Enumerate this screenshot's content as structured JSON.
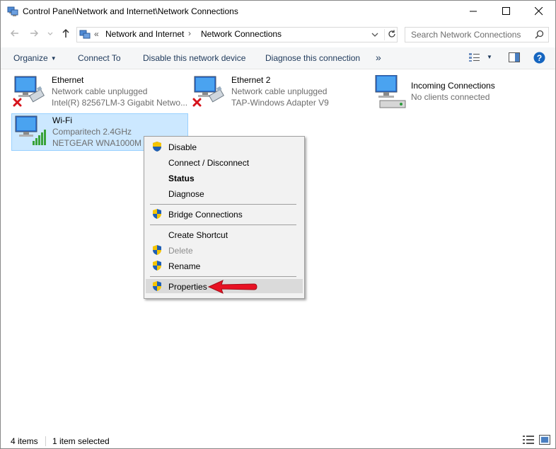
{
  "window": {
    "title": "Control Panel\\Network and Internet\\Network Connections",
    "controls": [
      "minimize",
      "maximize",
      "close"
    ]
  },
  "address": {
    "overflow": "«",
    "crumbs": [
      "Network and Internet",
      "Network Connections"
    ],
    "separator": "›"
  },
  "search": {
    "placeholder": "Search Network Connections"
  },
  "toolbar": {
    "organize": "Organize",
    "connect_to": "Connect To",
    "disable": "Disable this network device",
    "diagnose": "Diagnose this connection",
    "more": "»"
  },
  "items": [
    {
      "name": "Ethernet",
      "status": "Network cable unplugged",
      "device": "Intel(R) 82567LM-3 Gigabit Netwo...",
      "overlay": "red-x"
    },
    {
      "name": "Ethernet 2",
      "status": "Network cable unplugged",
      "device": "TAP-Windows Adapter V9",
      "overlay": "red-x"
    },
    {
      "name": "Incoming Connections",
      "status": "No clients connected",
      "device": ""
    },
    {
      "name": "Wi-Fi",
      "status": "Comparitech 2.4GHz",
      "device": "NETGEAR WNA1000M N",
      "overlay": "signal-bars",
      "selected": true
    }
  ],
  "context_menu": {
    "items": [
      {
        "label": "Disable",
        "shield": true
      },
      {
        "label": "Connect / Disconnect",
        "shield": false
      },
      {
        "label": "Status",
        "shield": false,
        "bold": true
      },
      {
        "label": "Diagnose",
        "shield": false
      },
      {
        "label": "Bridge Connections",
        "shield": true
      },
      {
        "label": "Create Shortcut",
        "shield": false
      },
      {
        "label": "Delete",
        "shield": true,
        "disabled": true
      },
      {
        "label": "Rename",
        "shield": true
      },
      {
        "label": "Properties",
        "shield": true,
        "highlighted": true
      }
    ]
  },
  "status": {
    "count": "4 items",
    "selected": "1 item selected"
  },
  "colors": {
    "selection": "#cce8ff",
    "accent": "#0078d7",
    "arrow": "#e81123",
    "toolbar_text": "#1e395b"
  }
}
